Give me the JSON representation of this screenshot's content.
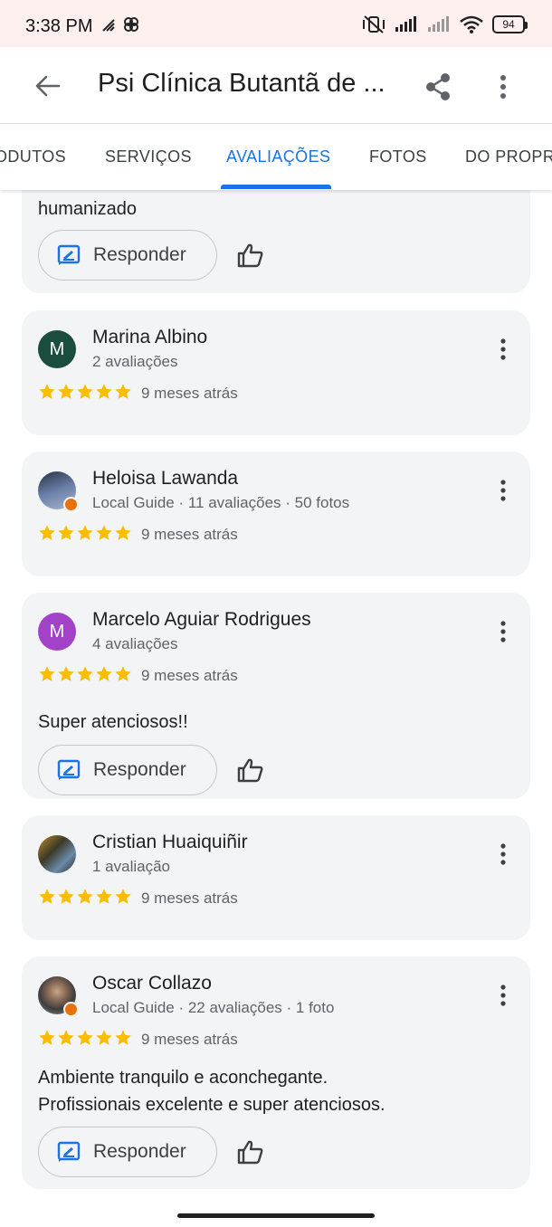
{
  "status_bar": {
    "time": "3:38 PM",
    "battery": "94"
  },
  "app_bar": {
    "title": "Psi Clínica Butantã de ..."
  },
  "tabs": [
    {
      "label": "ODUTOS"
    },
    {
      "label": "SERVIÇOS"
    },
    {
      "label": "AVALIAÇÕES",
      "active": true
    },
    {
      "label": "FOTOS"
    },
    {
      "label": "DO PROPRI"
    }
  ],
  "colors": {
    "accent": "#1a73e8",
    "star": "#fbbc04",
    "card_bg": "#f3f4f6"
  },
  "reply_label": "Responder",
  "top_partial": {
    "text": "humanizado"
  },
  "reviews": [
    {
      "name": "Marina Albino",
      "meta": "2 avaliações",
      "rating": 5,
      "time": "9 meses atrás",
      "text": "",
      "avatar_letter": "M",
      "avatar_color": "#1a4d3e"
    },
    {
      "name": "Heloisa Lawanda",
      "meta": "Local Guide · 11 avaliações · 50 fotos",
      "rating": 5,
      "time": "9 meses atrás",
      "text": "",
      "avatar_letter": "",
      "avatar_color": "#4a5a78",
      "local_guide": true
    },
    {
      "name": "Marcelo Aguiar Rodrigues",
      "meta": "4 avaliações",
      "rating": 5,
      "time": "9 meses atrás",
      "text": "Super atenciosos!!",
      "avatar_letter": "M",
      "avatar_color": "#a142c8"
    },
    {
      "name": "Cristian Huaiquiñir",
      "meta": "1 avaliação",
      "rating": 5,
      "time": "9 meses atrás",
      "text": "",
      "avatar_letter": "",
      "avatar_color": "#3b3a28"
    },
    {
      "name": "Oscar Collazo",
      "meta": "Local Guide · 22 avaliações · 1 foto",
      "rating": 5,
      "time": "9 meses atrás",
      "text": "Ambiente tranquilo e aconchegante.\nProfissionais excelente e super atenciosos.",
      "avatar_letter": "",
      "avatar_color": "#6b6f62",
      "local_guide": true
    }
  ]
}
